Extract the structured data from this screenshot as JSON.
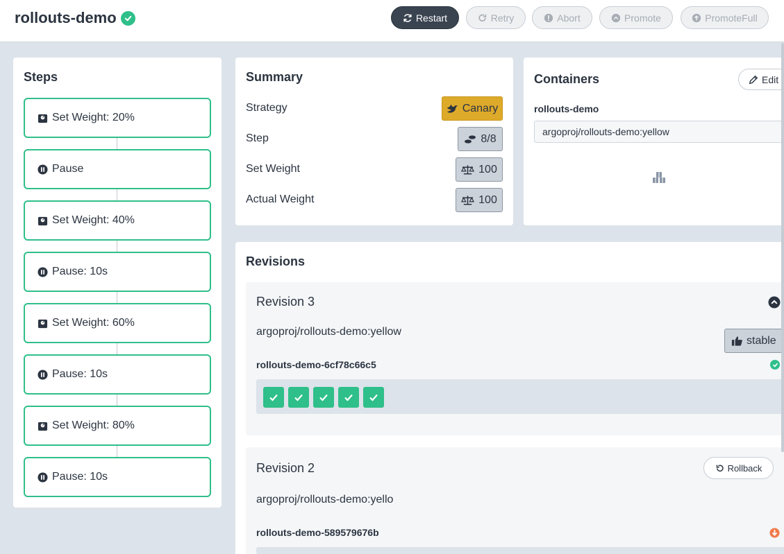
{
  "header": {
    "title": "rollouts-demo",
    "buttons": {
      "restart": "Restart",
      "retry": "Retry",
      "abort": "Abort",
      "promote": "Promote",
      "promote_full": "PromoteFull"
    }
  },
  "steps": {
    "title": "Steps",
    "items": [
      {
        "label": "Set Weight: 20%",
        "icon": "weight-icon"
      },
      {
        "label": "Pause",
        "icon": "pause-icon"
      },
      {
        "label": "Set Weight: 40%",
        "icon": "weight-icon"
      },
      {
        "label": "Pause: 10s",
        "icon": "pause-icon"
      },
      {
        "label": "Set Weight: 60%",
        "icon": "weight-icon"
      },
      {
        "label": "Pause: 10s",
        "icon": "pause-icon"
      },
      {
        "label": "Set Weight: 80%",
        "icon": "weight-icon"
      },
      {
        "label": "Pause: 10s",
        "icon": "pause-icon"
      }
    ]
  },
  "summary": {
    "title": "Summary",
    "strategy_label": "Strategy",
    "strategy_value": "Canary",
    "step_label": "Step",
    "step_value": "8/8",
    "set_weight_label": "Set Weight",
    "set_weight_value": "100",
    "actual_weight_label": "Actual Weight",
    "actual_weight_value": "100"
  },
  "containers": {
    "title": "Containers",
    "edit_label": "Edit",
    "container_name": "rollouts-demo",
    "image_value": "argoproj/rollouts-demo:yellow"
  },
  "revisions": {
    "title": "Revisions",
    "items": [
      {
        "title": "Revision 3",
        "image": "argoproj/rollouts-demo:yellow",
        "badge": "stable",
        "replicaset": "rollouts-demo-6cf78c66c5",
        "pods": 5
      },
      {
        "title": "Revision 2",
        "image": "argoproj/rollouts-demo:yello",
        "rollback_label": "Rollback",
        "replicaset": "rollouts-demo-589579676b"
      }
    ]
  },
  "colors": {
    "healthy": "#2fbf8a",
    "canary": "#deaa2a",
    "scaled_down": "#f07a4a",
    "dark_button": "#3a4451"
  }
}
